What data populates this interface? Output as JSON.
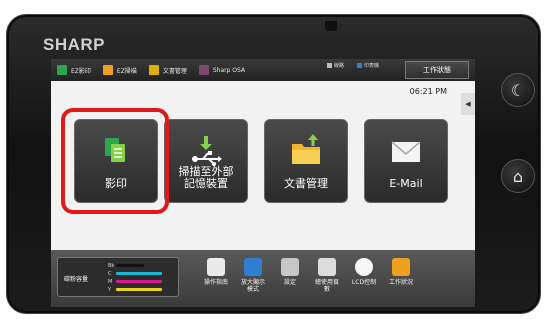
{
  "brand": "SHARP",
  "topbar": {
    "tabs": [
      {
        "label": "EZ影印",
        "icon": "copy-icon",
        "color": "#2ea44f"
      },
      {
        "label": "EZ掃描",
        "icon": "scan-icon",
        "color": "#f0a020"
      },
      {
        "label": "文書管理",
        "icon": "folder-icon",
        "color": "#e0b000"
      },
      {
        "label": "Sharp OSA",
        "icon": "osa-icon",
        "color": "#7c4a6f"
      }
    ],
    "indicator1": "線路",
    "indicator2": "印表機",
    "job_status": "工作狀態"
  },
  "clock": "06:21 PM",
  "tiles": [
    {
      "label": "影印",
      "icon": "copy-icon"
    },
    {
      "label_line1": "掃描至外部",
      "label_line2": "記憶裝置",
      "icon": "usb-icon"
    },
    {
      "label": "文書管理",
      "icon": "folder-icon"
    },
    {
      "label": "E-Mail",
      "icon": "envelope-icon"
    }
  ],
  "toner": {
    "label": "碳粉容量",
    "rows": [
      {
        "key": "Bk",
        "color": "#111111",
        "level": 0.6
      },
      {
        "key": "C",
        "color": "#1fb7d6",
        "level": 0.85
      },
      {
        "key": "M",
        "color": "#d81a8a",
        "level": 0.85
      },
      {
        "key": "Y",
        "color": "#e6d51a",
        "level": 0.85
      }
    ]
  },
  "bottom_items": [
    {
      "label": "操作指南",
      "icon": "guide-icon"
    },
    {
      "label_line1": "放大顯示",
      "label_line2": "模式",
      "icon": "magnify-icon"
    },
    {
      "label": "設定",
      "icon": "settings-icon"
    },
    {
      "label_line1": "總使用頁",
      "label_line2": "數",
      "icon": "counter-icon"
    },
    {
      "label": "LCD控制",
      "icon": "brightness-icon"
    },
    {
      "label": "工作狀況",
      "icon": "job-icon"
    }
  ],
  "accent_colors": {
    "highlight": "#e31919"
  }
}
